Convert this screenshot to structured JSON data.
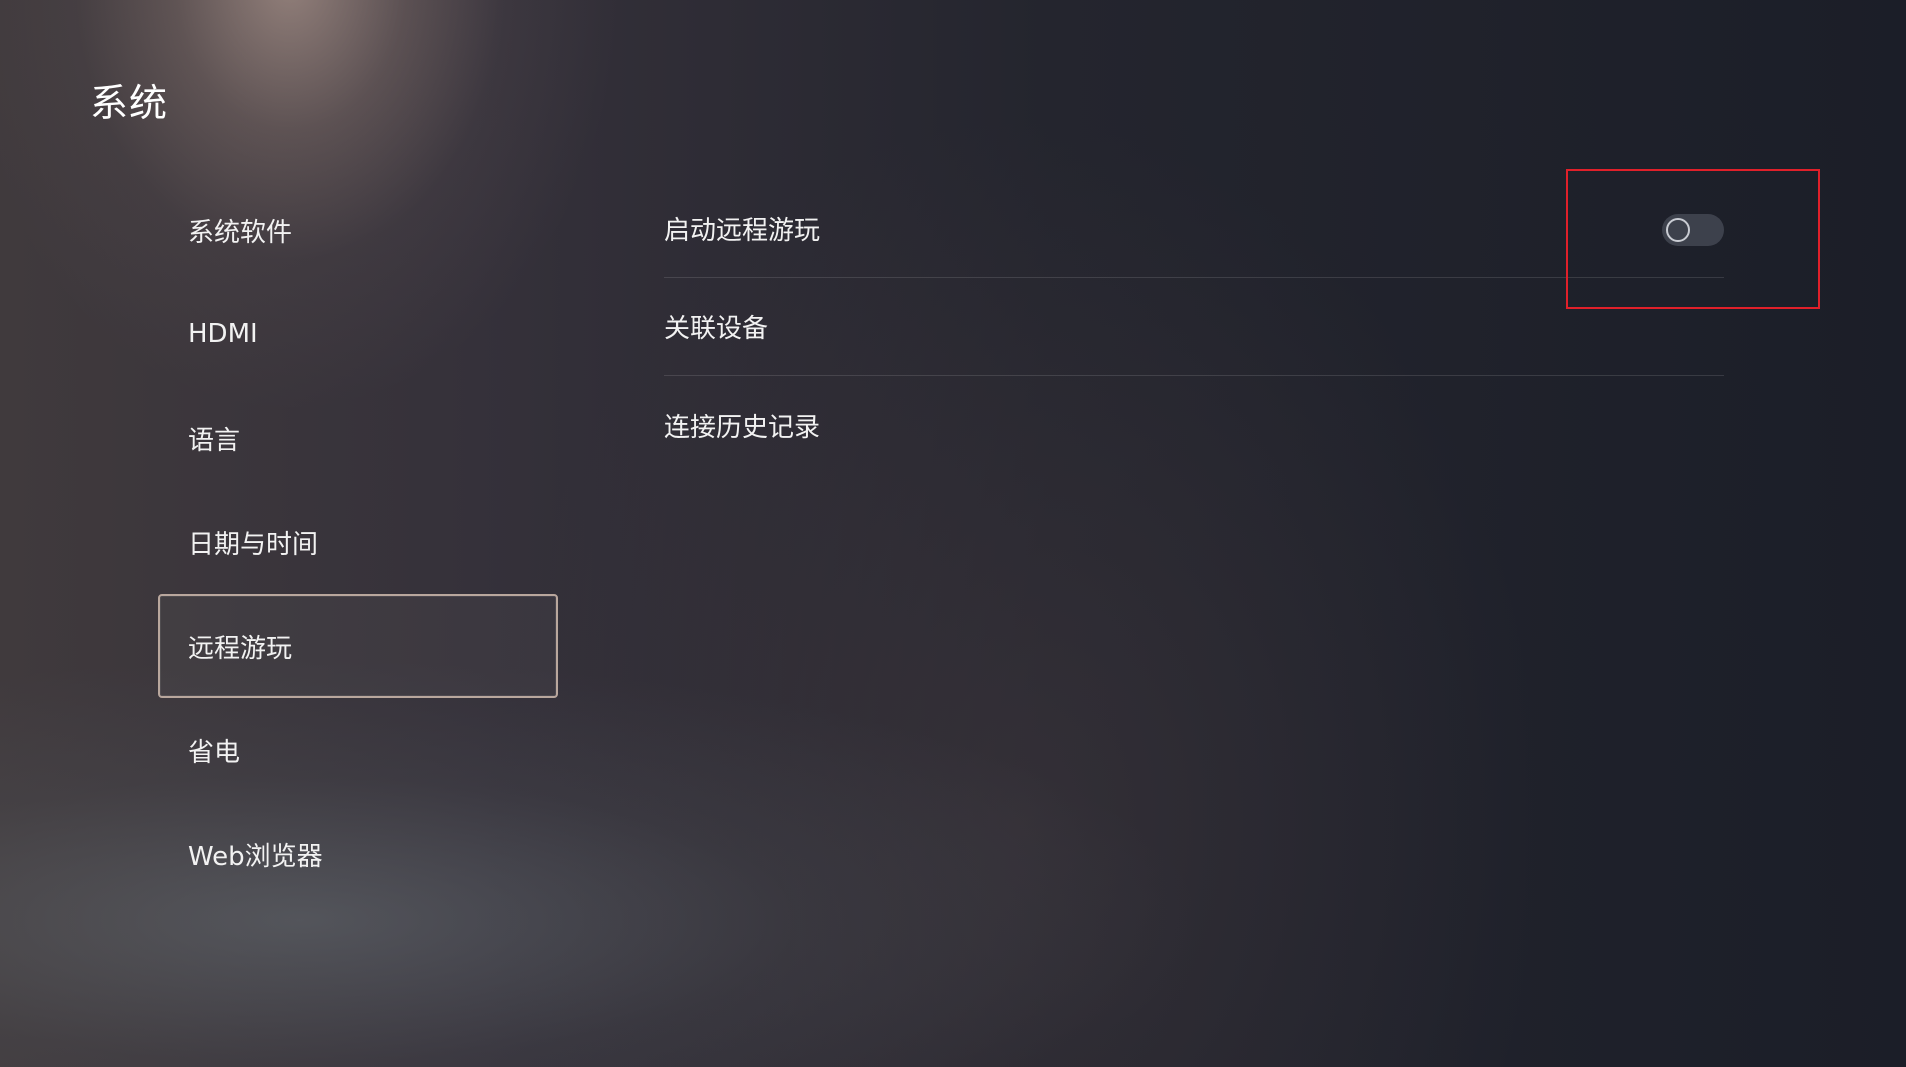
{
  "page": {
    "title": "系统"
  },
  "sidebar": {
    "items": [
      {
        "label": "系统软件",
        "selected": false
      },
      {
        "label": "HDMI",
        "selected": false
      },
      {
        "label": "语言",
        "selected": false
      },
      {
        "label": "日期与时间",
        "selected": false
      },
      {
        "label": "远程游玩",
        "selected": true
      },
      {
        "label": "省电",
        "selected": false
      },
      {
        "label": "Web浏览器",
        "selected": false
      }
    ]
  },
  "content": {
    "rows": [
      {
        "label": "启动远程游玩",
        "control": "toggle",
        "toggle_on": false
      },
      {
        "label": "关联设备"
      },
      {
        "label": "连接历史记录"
      }
    ]
  },
  "colors": {
    "selection_border": "#b9a79d",
    "highlight_box": "#e0202a",
    "toggle_track": "#3d414c"
  }
}
